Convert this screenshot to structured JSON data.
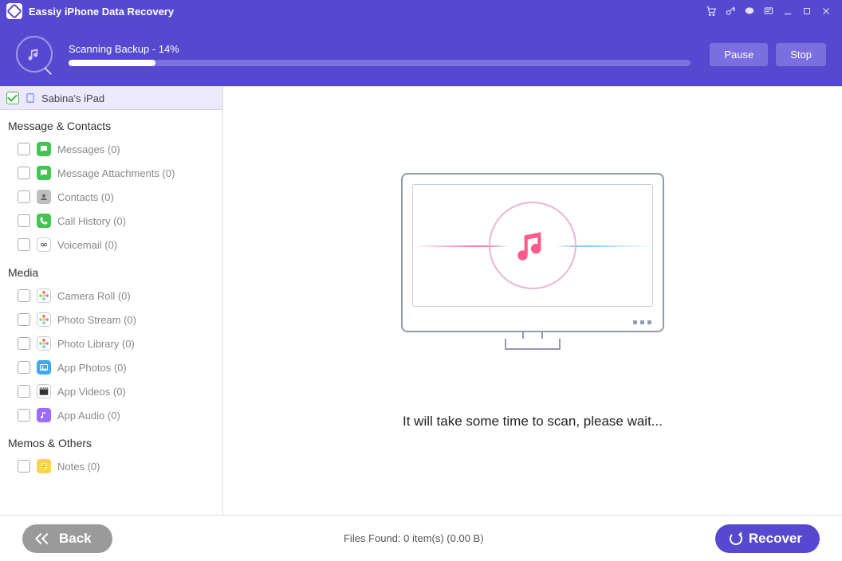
{
  "app": {
    "title": "Eassiy iPhone Data Recovery"
  },
  "titlebar_icons": [
    "cart",
    "key",
    "chat",
    "notes",
    "minimize",
    "maximize",
    "close"
  ],
  "scan": {
    "label": "Scanning Backup - 14%",
    "percent": 14,
    "pause_label": "Pause",
    "stop_label": "Stop"
  },
  "device": {
    "name": "Sabina's iPad",
    "checked": true
  },
  "groups": [
    {
      "title": "Message & Contacts",
      "items": [
        {
          "label": "Messages (0)",
          "icon_bg": "#44c553",
          "icon_glyph": "msg"
        },
        {
          "label": "Message Attachments (0)",
          "icon_bg": "#44c553",
          "icon_glyph": "msg"
        },
        {
          "label": "Contacts (0)",
          "icon_bg": "#bfbfbf",
          "icon_glyph": "contact"
        },
        {
          "label": "Call History (0)",
          "icon_bg": "#44c553",
          "icon_glyph": "call"
        },
        {
          "label": "Voicemail (0)",
          "icon_bg": "#ffffff",
          "icon_glyph": "vm",
          "icon_fg": "#555",
          "border": true
        }
      ]
    },
    {
      "title": "Media",
      "items": [
        {
          "label": "Camera Roll (0)",
          "icon_bg": "#fff",
          "icon_glyph": "flower",
          "border": true
        },
        {
          "label": "Photo Stream (0)",
          "icon_bg": "#fff",
          "icon_glyph": "flower",
          "border": true
        },
        {
          "label": "Photo Library (0)",
          "icon_bg": "#fff",
          "icon_glyph": "flower",
          "border": true
        },
        {
          "label": "App Photos (0)",
          "icon_bg": "#3fa9f5",
          "icon_glyph": "photo"
        },
        {
          "label": "App Videos (0)",
          "icon_bg": "#fff",
          "icon_glyph": "clap",
          "border": true
        },
        {
          "label": "App Audio (0)",
          "icon_bg": "#9c6bff",
          "icon_glyph": "audio"
        }
      ]
    },
    {
      "title": "Memos & Others",
      "items": [
        {
          "label": "Notes (0)",
          "icon_bg": "#ffd24d",
          "icon_glyph": "notes"
        }
      ]
    }
  ],
  "main": {
    "wait_text": "It will take some time to scan, please wait..."
  },
  "footer": {
    "back_label": "Back",
    "status": "Files Found: 0 item(s) (0.00 B)",
    "recover_label": "Recover"
  }
}
